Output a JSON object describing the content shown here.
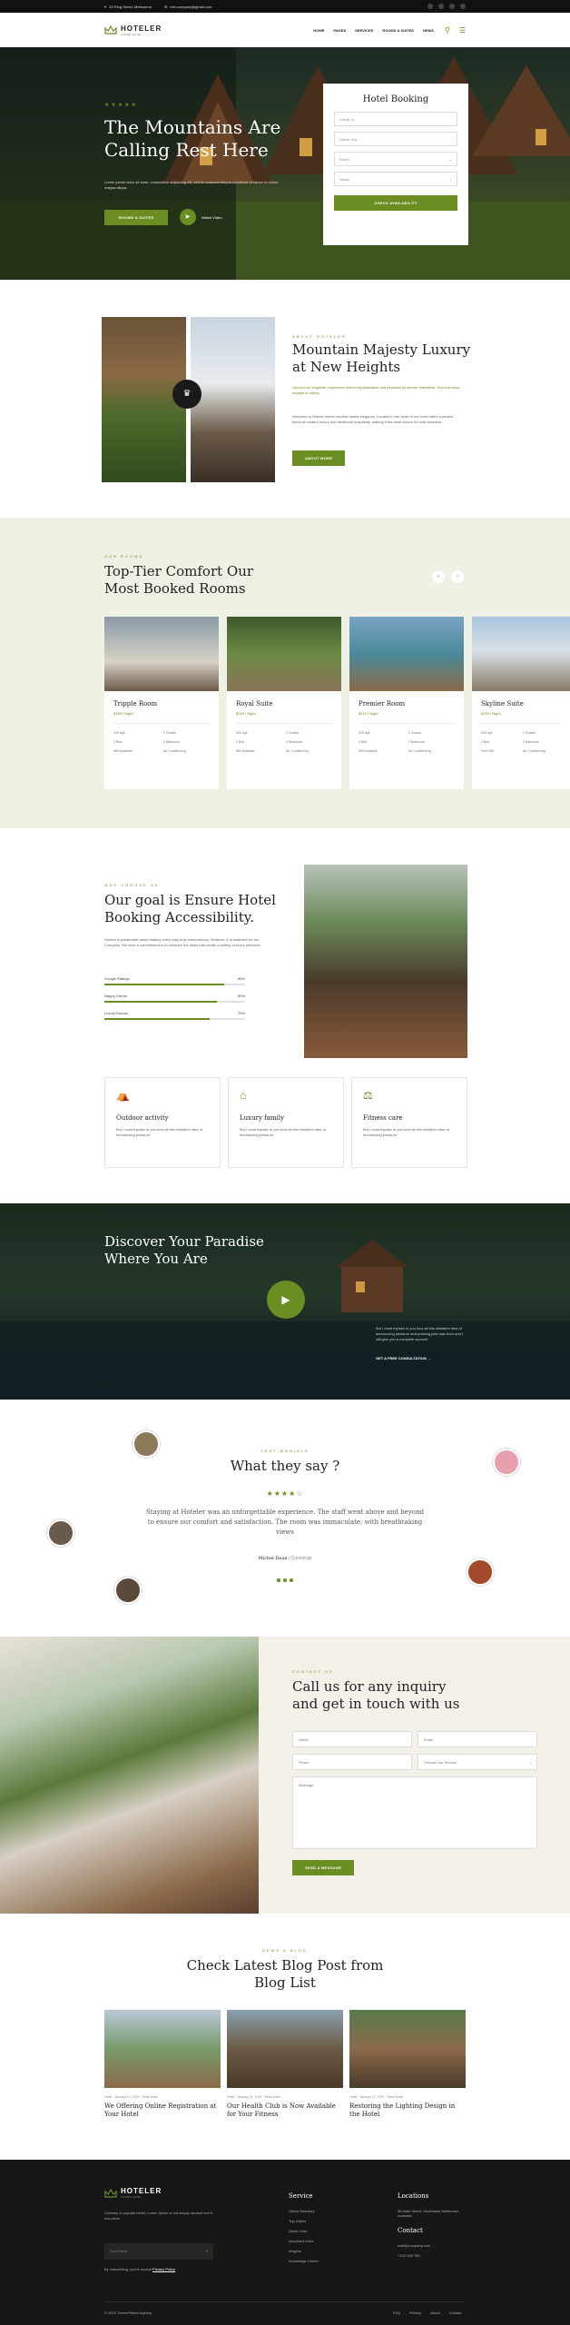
{
  "topbar": {
    "address": "33 Ring Street, Melbourne",
    "email": "info.company@gmail.com"
  },
  "brand": {
    "name": "HOTELER",
    "tagline": "LUXURY HOTEL"
  },
  "nav": {
    "items": [
      "HOME",
      "PAGES",
      "SERVICES",
      "ROOMS & SUITES",
      "NEWS"
    ]
  },
  "hero": {
    "title": "The Mountains Are Calling Rest Here",
    "text": "Lorem ipsum dolor sit amet, consectetur adipiscing elit, sed do eiusmod tempor incididunt ut labore et dolore magna aliqua.",
    "cta": "ROOMS & SUITES",
    "watch": "Watch Video"
  },
  "booking": {
    "title": "Hotel Booking",
    "checkin": "Check In",
    "checkout": "Check Out",
    "room": "Room",
    "guest": "Guest",
    "submit": "CHECK AVAILABILITY"
  },
  "about": {
    "kicker": "ABOUT HOTELER",
    "title": "Mountain Majesty Luxury at New Heights",
    "lead": "Uncover an exquisite experience where sophistication and personal jet service intertwine. Your luxurious escape in calling",
    "text": "Welcome to Hoteler where comfort meets elegance. Located in the heart of our hotel offers a perfect blend of modern luxury and traditional hospitality, making it the ideal choice for both business.",
    "btn": "ABOUT MORE"
  },
  "rooms": {
    "kicker": "OUR ROOMS",
    "title": "Top-Tier Comfort Our Most Booked Rooms",
    "items": [
      {
        "name": "Tripple Room",
        "price": "$189 / Night",
        "a": [
          "320 sqft",
          "2 Guests",
          "2 Bed",
          "2 Bathroom",
          "Wifi Available",
          "Air Conditioning"
        ]
      },
      {
        "name": "Royal Suite",
        "price": "$249 / Night",
        "a": [
          "320 sqft",
          "2 Guests",
          "2 Bed",
          "2 Bathroom",
          "Wifi Available",
          "Air Conditioning"
        ]
      },
      {
        "name": "Premier Room",
        "price": "$219 / Night",
        "a": [
          "320 sqft",
          "2 Guests",
          "2 Bed",
          "2 Bathroom",
          "Wifi Available",
          "Air Conditioning"
        ]
      },
      {
        "name": "Skyline Suite",
        "price": "$299 / Night",
        "a": [
          "320 sqft",
          "2 Guests",
          "2 Bed",
          "2 Bathroom",
          "Free Wifi",
          "Air Conditioning"
        ]
      }
    ]
  },
  "goal": {
    "kicker": "WHY CHOOSE US",
    "title": "Our goal is Ensure Hotel Booking Accessibility.",
    "text": "Hoteler is passionate about making every stay truly extraordinary. However, it is essential for our Company. We have a commitment is to enhance the ideas that create a setting of every welcome.",
    "bars": [
      {
        "label": "Google Ratings",
        "value": 85,
        "text": "85%"
      },
      {
        "label": "Happy Clients",
        "value": 80,
        "text": "80%"
      },
      {
        "label": "Luxury Rooms",
        "value": 75,
        "text": "75%"
      }
    ]
  },
  "features": [
    {
      "title": "Outdoor activity",
      "text": "But I must explain to you how all this mistaken idea of denouncing pleasure"
    },
    {
      "title": "Luxury family",
      "text": "But I must explain to you how all this mistaken idea of denouncing pleasure"
    },
    {
      "title": "Fitness care",
      "text": "But I must explain to you how all this mistaken idea of denouncing pleasure"
    }
  ],
  "video": {
    "title": "Discover Your Paradise Where You Are",
    "text": "But I must explain to you how all this mistaken idea of denouncing pleasure and praising pain was born and I will give you a complete account",
    "link": "GET A FREE CONSULTATION →"
  },
  "testimonial": {
    "kicker": "TESTIMONIALS",
    "title": "What they say ?",
    "quote": "Staying at Hoteler was an unforgettable experience. The staff went above and beyond to ensure our comfort and satisfaction. The room was immaculate, with breathtaking views",
    "name": "Michel Dean",
    "role": "/ Concierge",
    "rating": 4
  },
  "contact": {
    "kicker": "CONTACT US",
    "title": "Call us for any inquiry and get in touch with us",
    "name": "Name",
    "email": "Email",
    "phone": "Phone",
    "service": "Choose Our Service",
    "message": "Message",
    "btn": "SEND A MESSAGE"
  },
  "blog": {
    "kicker": "NEWS & BLOG",
    "title": "Check Latest Blog Post from Blog List",
    "posts": [
      {
        "meta": "Hotel  ·  January 12, 2024  ·  Read More",
        "title": "We Offering Online Registration at Your Hotel"
      },
      {
        "meta": "Hotel  ·  January 12, 2024  ·  Read More",
        "title": "Our Health Club is Now Available for Your Fitness"
      },
      {
        "meta": "Hotel  ·  January 12, 2024  ·  Read More",
        "title": "Restoring the Lighting Design in the Hotel"
      }
    ]
  },
  "footer": {
    "text": "Contrary to popular belief, Lorem Ipsum is not simply random text it has piece",
    "email_ph": "Your Email",
    "agree": "By subscribing, you're accept",
    "policy": "Privacy Policy",
    "service_title": "Service",
    "services": [
      "Online Directory",
      "Trip Hotels",
      "Quick Links",
      "Important Links",
      "Insights",
      "Knowledge Center"
    ],
    "loc_title": "Locations",
    "address": "36 Main Street, Southbank Melbourne, Australia",
    "contact_title": "Contact",
    "mail": "mail@company.com",
    "phone": "+123 456 789",
    "copyright": "© 2024 ThemePlanet Agency",
    "links": [
      "FAQ",
      "Privacy",
      "About",
      "Contact"
    ]
  },
  "colors": {
    "accent": "#6b8e23",
    "dark": "#161616",
    "cream": "#eef1e4"
  }
}
